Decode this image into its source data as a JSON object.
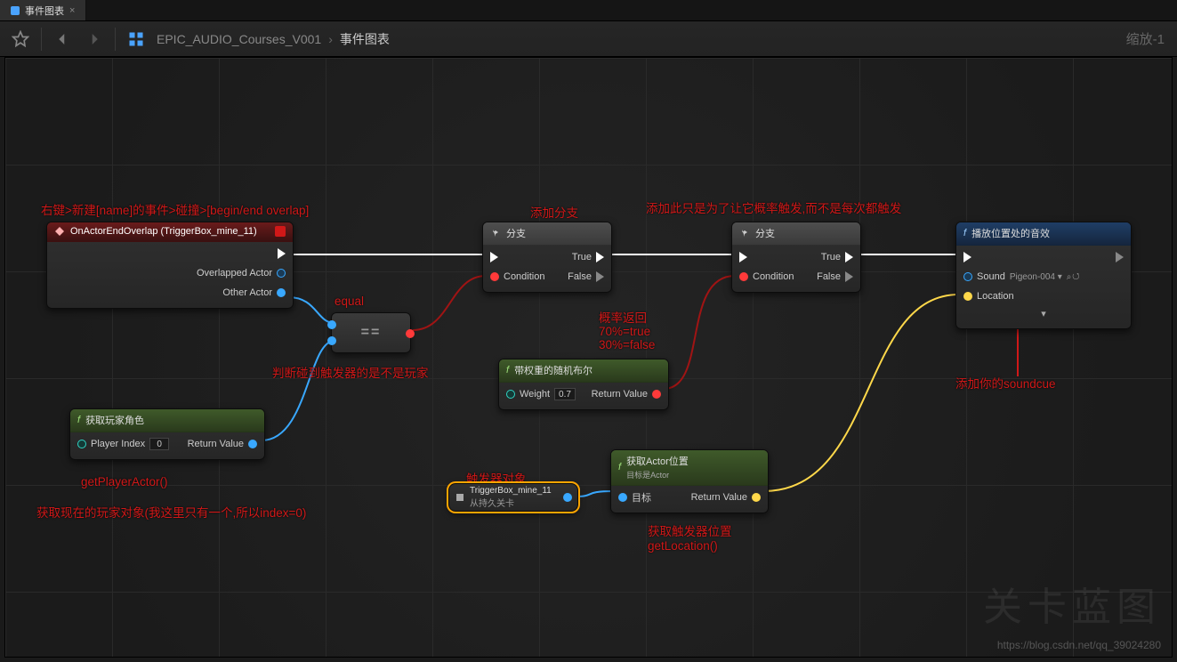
{
  "tab": {
    "title": "事件图表"
  },
  "breadcrumb": {
    "a": "EPIC_AUDIO_Courses_V001",
    "b": "事件图表"
  },
  "zoom": "缩放-1",
  "watermark": "关卡蓝图",
  "watermark_url": "https://blog.csdn.net/qq_39024280",
  "anno": {
    "create_event": "右键>新建[name]的事件>碰撞>[begin/end overlap]",
    "add_branch": "添加分支",
    "prob_note": "添加此只是为了让它概率触发,而不是每次都触发",
    "equal": "equal",
    "judge_player": "判断碰到触发器的是不是玩家",
    "prob_return": "概率返回\n70%=true\n30%=false",
    "get_player_fn": "getPlayerActor()",
    "get_player_desc": "获取现在的玩家对象(我这里只有一个,所以index=0)",
    "trigger_obj": "触发器对象",
    "get_loc": "获取触发器位置\ngetLocation()",
    "add_cue": "添加你的soundcue"
  },
  "node_event": {
    "title": "OnActorEndOverlap (TriggerBox_mine_11)",
    "overlapped": "Overlapped Actor",
    "other": "Other Actor"
  },
  "node_branch": {
    "title": "分支",
    "cond": "Condition",
    "t": "True",
    "f": "False"
  },
  "node_randbool": {
    "title": "带权重的随机布尔",
    "weight": "Weight",
    "weight_val": "0.7",
    "ret": "Return Value"
  },
  "node_player": {
    "title": "获取玩家角色",
    "index": "Player Index",
    "index_val": "0",
    "ret": "Return Value"
  },
  "node_var": {
    "title": "TriggerBox_mine_11",
    "sub": "从持久关卡"
  },
  "node_loc": {
    "title": "获取Actor位置",
    "sub": "目标是Actor",
    "target": "目标",
    "ret": "Return Value"
  },
  "node_sound": {
    "title": "播放位置处的音效",
    "sound": "Sound",
    "sound_val": "Pigeon-004",
    "loc": "Location"
  },
  "compact": {
    "op": "=="
  }
}
